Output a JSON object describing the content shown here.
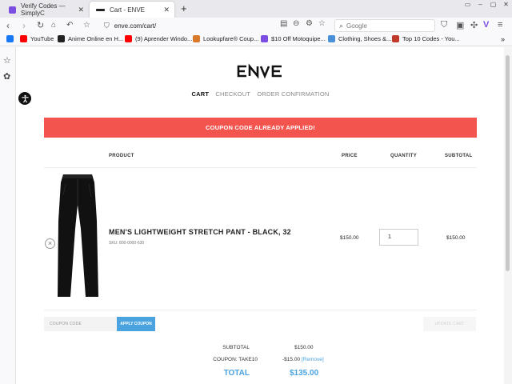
{
  "browser": {
    "tabs": [
      {
        "title": "Verify Codes — SimplyC",
        "active": false
      },
      {
        "title": "Cart - ENVE",
        "active": true
      }
    ],
    "url": "enve.com/cart/",
    "search_placeholder": "Google",
    "bookmarks": [
      {
        "label": "",
        "color": "#1877f2"
      },
      {
        "label": "YouTube",
        "color": "#ff0000"
      },
      {
        "label": "Anime Online en H...",
        "color": "#222222"
      },
      {
        "label": "(9) Aprender Windo...",
        "color": "#ff0000"
      },
      {
        "label": "Lookupfare® Coup...",
        "color": "#d97a2b"
      },
      {
        "label": "$10 Off Motoquipe...",
        "color": "#7b4de0"
      },
      {
        "label": "Clothing, Shoes &...",
        "color": "#4a90d9"
      },
      {
        "label": "Top 10 Codes - You...",
        "color": "#c0392b"
      }
    ]
  },
  "brand": {
    "logo_text": "ENVE"
  },
  "steps": [
    {
      "label": "CART",
      "active": true
    },
    {
      "label": "CHECKOUT",
      "active": false
    },
    {
      "label": "ORDER CONFIRMATION",
      "active": false
    }
  ],
  "alert": {
    "message": "COUPON CODE ALREADY APPLIED!",
    "color": "#f3554e"
  },
  "table": {
    "headers": {
      "product": "PRODUCT",
      "price": "PRICE",
      "quantity": "QUANTITY",
      "subtotal": "SUBTOTAL"
    }
  },
  "cart_item": {
    "name": "MEN'S LIGHTWEIGHT STRETCH PANT - BLACK, 32",
    "sku": "SKU: 800-0000-630",
    "price": "$150.00",
    "quantity": "1",
    "subtotal": "$150.00"
  },
  "coupon": {
    "placeholder": "COUPON CODE",
    "apply_label": "APPLY COUPON",
    "update_label": "UPDATE CART"
  },
  "totals": {
    "subtotal_label": "SUBTOTAL",
    "subtotal_value": "$150.00",
    "coupon_label": "COUPON: TAKE10",
    "coupon_value": "-$15.00",
    "coupon_remove": "[Remove]",
    "total_label": "TOTAL",
    "total_value": "$135.00"
  },
  "colors": {
    "accent": "#4aa3df",
    "alert": "#f3554e"
  }
}
